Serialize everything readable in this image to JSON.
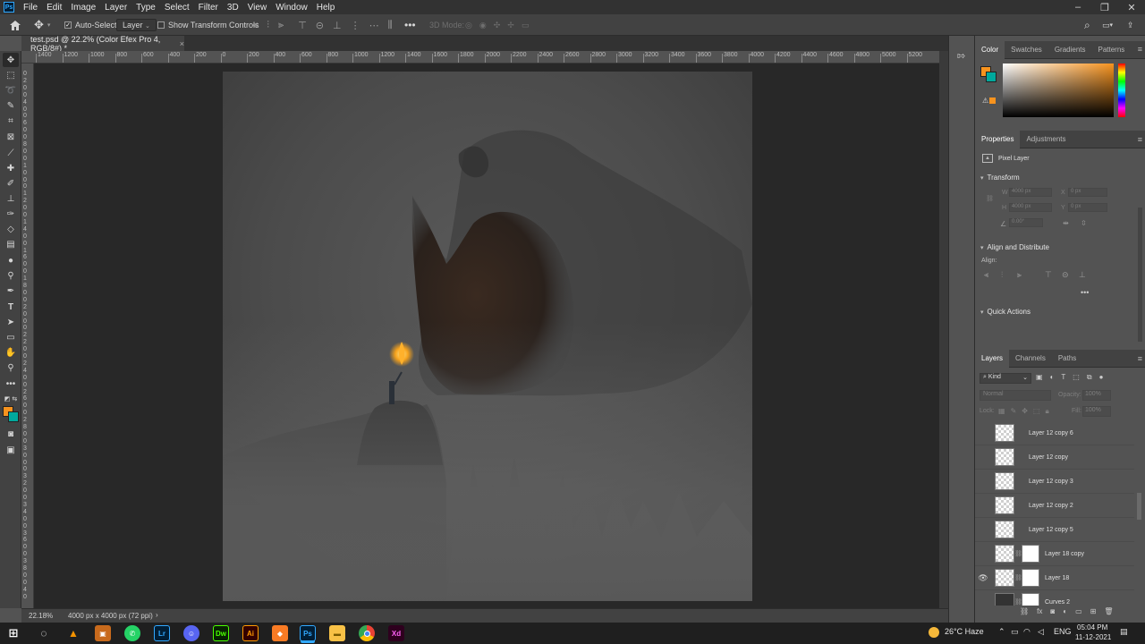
{
  "app": {
    "logo": "Ps",
    "menu": [
      "File",
      "Edit",
      "Image",
      "Layer",
      "Type",
      "Select",
      "Filter",
      "3D",
      "View",
      "Window",
      "Help"
    ]
  },
  "options_bar": {
    "auto_select_label": "Auto-Select:",
    "auto_select_checked": true,
    "target_value": "Layer",
    "show_transform_label": "Show Transform Controls",
    "mode_3d_label": "3D Mode:",
    "more_label": "•••"
  },
  "document": {
    "tab_title": "test.psd @ 22.2% (Color Efex Pro 4, RGB/8#) *",
    "close_glyph": "×"
  },
  "ruler": {
    "top": [
      "1400",
      "1200",
      "1000",
      "800",
      "600",
      "400",
      "200",
      "0",
      "200",
      "400",
      "600",
      "800",
      "1000",
      "1200",
      "1400",
      "1600",
      "1800",
      "2000",
      "2200",
      "2400",
      "2600",
      "2800",
      "3000",
      "3200",
      "3400",
      "3600",
      "3800",
      "4000",
      "4200",
      "4400",
      "4600",
      "4800",
      "5000",
      "5200"
    ],
    "left": [
      "0",
      "2",
      "0",
      "0",
      "4",
      "0",
      "0",
      "6",
      "0",
      "0",
      "8",
      "0",
      "0",
      "1",
      "0",
      "0",
      "0",
      "1",
      "2",
      "0",
      "0",
      "1",
      "4",
      "0",
      "0",
      "1",
      "6",
      "0",
      "0",
      "1",
      "8",
      "0",
      "0",
      "2",
      "0",
      "0",
      "0",
      "2",
      "2",
      "0",
      "0",
      "2",
      "4",
      "0",
      "0",
      "2",
      "6",
      "0",
      "0",
      "2",
      "8",
      "0",
      "0",
      "3",
      "0",
      "0",
      "0",
      "3",
      "2",
      "0",
      "0",
      "3",
      "4",
      "0",
      "0",
      "3",
      "6",
      "0",
      "0",
      "3",
      "8",
      "0",
      "0",
      "4",
      "0",
      "0"
    ]
  },
  "status": {
    "zoom": "22.18%",
    "doc_size": "4000 px x 4000 px (72 ppi)",
    "arrow": "›"
  },
  "colors": {
    "foreground": "#f7931e",
    "background": "#00a99d",
    "panel": "#535353",
    "accent": "#31a8ff"
  },
  "color_panel": {
    "tabs": [
      "Color",
      "Swatches",
      "Gradients",
      "Patterns"
    ],
    "active": "Color"
  },
  "properties_panel": {
    "tabs": [
      "Properties",
      "Adjustments"
    ],
    "active": "Properties",
    "layer_type": "Pixel Layer",
    "transform": {
      "title": "Transform",
      "w_label": "W",
      "w_value": "4000 px",
      "x_label": "X",
      "x_value": "0 px",
      "h_label": "H",
      "h_value": "4000 px",
      "y_label": "Y",
      "y_value": "0 px",
      "angle_value": "0.00°"
    },
    "align": {
      "title": "Align and Distribute",
      "align_label": "Align:",
      "more": "•••"
    },
    "quick_actions": "Quick Actions"
  },
  "layers_panel": {
    "tabs": [
      "Layers",
      "Channels",
      "Paths"
    ],
    "active": "Layers",
    "filter_kind": "Kind",
    "blend_mode": "Normal",
    "opacity_label": "Opacity:",
    "opacity_value": "100%",
    "lock_label": "Lock:",
    "fill_label": "Fill:",
    "fill_value": "100%",
    "layers": [
      {
        "name": "Layer 12 copy 6",
        "visible": false,
        "mask": false
      },
      {
        "name": "Layer 12 copy",
        "visible": false,
        "mask": false
      },
      {
        "name": "Layer 12 copy 3",
        "visible": false,
        "mask": false
      },
      {
        "name": "Layer 12 copy 2",
        "visible": false,
        "mask": false
      },
      {
        "name": "Layer 12 copy 5",
        "visible": false,
        "mask": false
      },
      {
        "name": "Layer 18 copy",
        "visible": false,
        "mask": true
      },
      {
        "name": "Layer 18",
        "visible": true,
        "mask": true
      }
    ],
    "partial_row_label": "Curves 2"
  },
  "taskbar": {
    "weather": "26°C Haze",
    "lang": "ENG",
    "time": "05:04 PM",
    "date": "11-12-2021",
    "apps": [
      "Lr",
      "Dw",
      "Ai",
      "Ps",
      "Xd"
    ]
  }
}
